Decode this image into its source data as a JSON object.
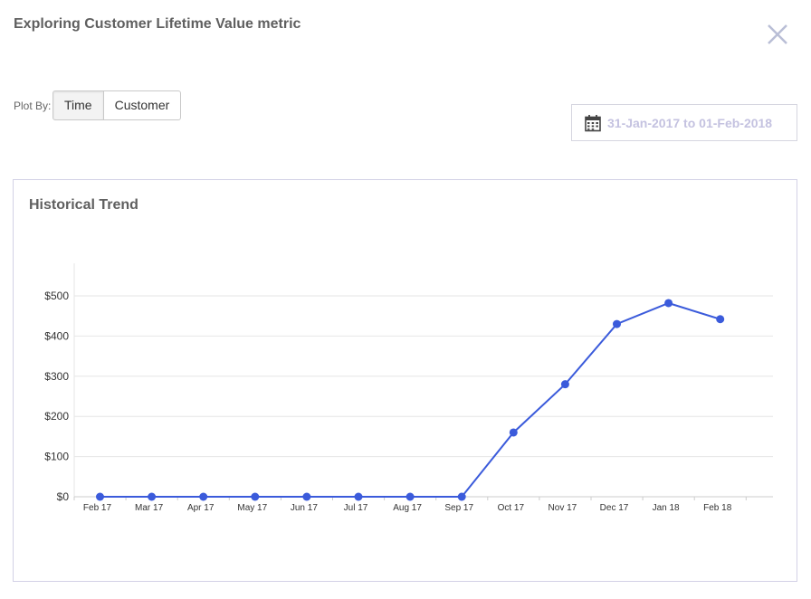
{
  "header": {
    "title": "Exploring Customer Lifetime Value metric"
  },
  "controls": {
    "plot_by_label": "Plot By:",
    "options": [
      "Time",
      "Customer"
    ],
    "selected": "Time",
    "date_range": "31-Jan-2017 to 01-Feb-2018"
  },
  "card": {
    "title": "Historical Trend"
  },
  "colors": {
    "series": "#3b5bdb",
    "date_text": "#c4c2e0",
    "card_border": "#d3d1e6"
  },
  "chart_data": {
    "type": "line",
    "title": "Historical Trend",
    "categories": [
      "Feb 17",
      "Mar 17",
      "Apr 17",
      "May 17",
      "Jun 17",
      "Jul 17",
      "Aug 17",
      "Sep 17",
      "Oct 17",
      "Nov 17",
      "Dec 17",
      "Jan 18",
      "Feb 18"
    ],
    "series": [
      {
        "values": [
          0,
          0,
          0,
          0,
          0,
          0,
          0,
          0,
          160,
          280,
          430,
          482,
          442
        ]
      }
    ],
    "ylim": [
      0,
      580
    ],
    "yticks": [
      0,
      100,
      200,
      300,
      400,
      500
    ],
    "ytick_labels": [
      "$0",
      "$100",
      "$200",
      "$300",
      "$400",
      "$500"
    ],
    "xlabel": "",
    "ylabel": "",
    "grid": true,
    "legend": "none"
  }
}
